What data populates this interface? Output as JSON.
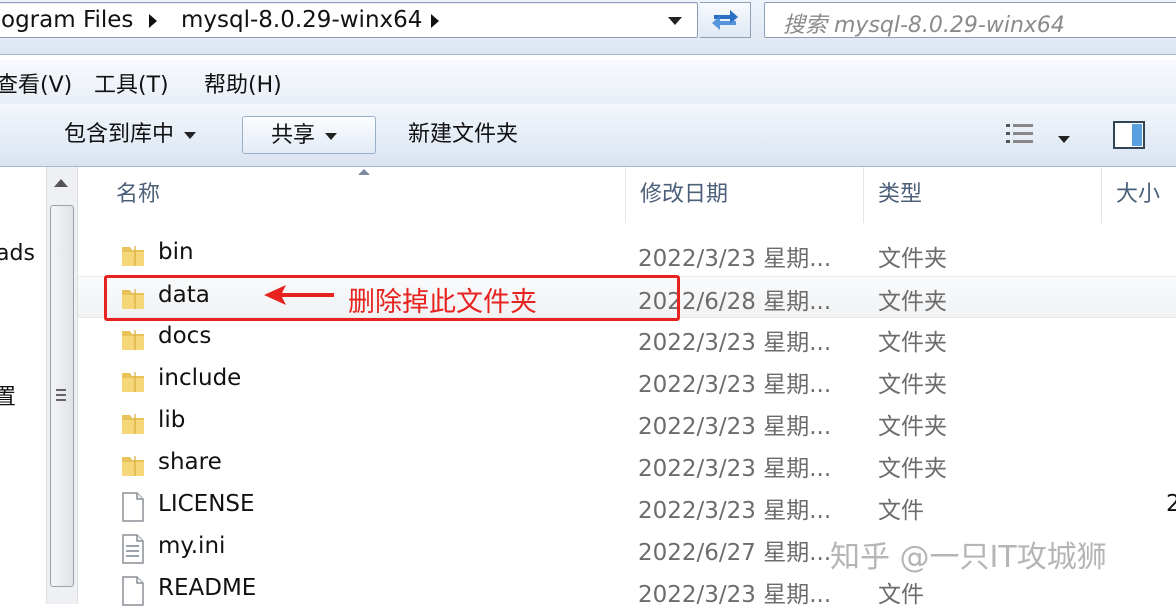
{
  "address": {
    "crumbs": [
      "ogram Files",
      "mysql-8.0.29-winx64"
    ],
    "search_placeholder": "搜索 mysql-8.0.29-winx64"
  },
  "menu": [
    "查看(V)",
    "工具(T)",
    "帮助(H)"
  ],
  "toolbar": {
    "include_library": "包含到库中",
    "share": "共享",
    "new_folder": "新建文件夹"
  },
  "nav": {
    "items": [
      "ads",
      "置"
    ]
  },
  "columns": {
    "name": "名称",
    "date_modified": "修改日期",
    "type": "类型",
    "size": "大小"
  },
  "files": [
    {
      "name": "bin",
      "date": "2022/3/23 星期...",
      "type": "文件夹",
      "size": "",
      "icon": "folder-icon"
    },
    {
      "name": "data",
      "date": "2022/6/28 星期...",
      "type": "文件夹",
      "size": "",
      "icon": "folder-icon"
    },
    {
      "name": "docs",
      "date": "2022/3/23 星期...",
      "type": "文件夹",
      "size": "",
      "icon": "folder-icon"
    },
    {
      "name": "include",
      "date": "2022/3/23 星期...",
      "type": "文件夹",
      "size": "",
      "icon": "folder-icon"
    },
    {
      "name": "lib",
      "date": "2022/3/23 星期...",
      "type": "文件夹",
      "size": "",
      "icon": "folder-icon"
    },
    {
      "name": "share",
      "date": "2022/3/23 星期...",
      "type": "文件夹",
      "size": "",
      "icon": "folder-icon"
    },
    {
      "name": "LICENSE",
      "date": "2022/3/23 星期...",
      "type": "文件",
      "size": "2",
      "icon": "file-icon"
    },
    {
      "name": "my.ini",
      "date": "2022/6/27 星期...",
      "type": "",
      "size": "",
      "icon": "ini-file-icon"
    },
    {
      "name": "README",
      "date": "2022/3/23 星期...",
      "type": "文件",
      "size": "",
      "icon": "file-icon"
    }
  ],
  "annotation": {
    "text": "删除掉此文件夹",
    "color": "#e8231f"
  },
  "watermark": "知乎 @一只IT攻城狮",
  "colors": {
    "column_header": "#4c607a",
    "secondary_text": "#6c6c6c"
  }
}
